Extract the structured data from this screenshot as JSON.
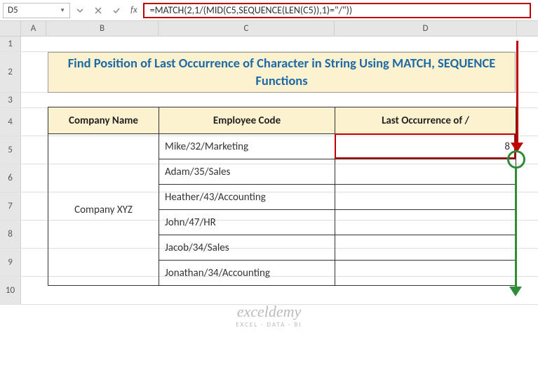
{
  "toolbar": {
    "namebox": "D5",
    "formula": "=MATCH(2,1/(MID(C5,SEQUENCE(LEN(C5)),1)=\"/\"))"
  },
  "columns": [
    "A",
    "B",
    "C",
    "D"
  ],
  "rownums": [
    "1",
    "2",
    "3",
    "4",
    "5",
    "6",
    "7",
    "8",
    "9",
    "10"
  ],
  "banner": "Find Position of Last Occurrence of Character in String Using MATCH, SEQUENCE Functions",
  "headers": {
    "company": "Company Name",
    "employee": "Employee Code",
    "last": "Last Occurrence of /"
  },
  "company": "Company XYZ",
  "employees": [
    "Mike/32/Marketing",
    "Adam/35/Sales",
    "Heather/43/Accounting",
    "John/47/HR",
    "Jacob/34/Sales",
    "Jonathan/34/Accounting"
  ],
  "result_d5": "8",
  "watermark": {
    "brand": "exceldemy",
    "sub": "EXCEL · DATA · BI"
  }
}
